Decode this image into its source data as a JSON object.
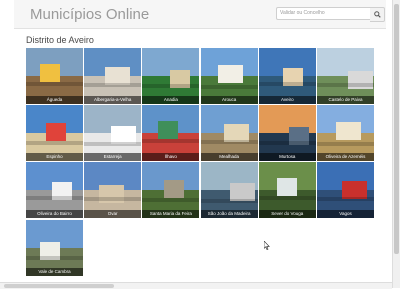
{
  "header": {
    "title": "Municípios Online",
    "search_placeholder": "Validar ou Concelho",
    "search_icon": "search-icon"
  },
  "section": {
    "title": "Distrito de Aveiro"
  },
  "municipalities": [
    {
      "name": "Águeda",
      "slug": "agueda",
      "sky": "#7d9fc0",
      "ground": "#8a6a45",
      "accent": "#f0c040"
    },
    {
      "name": "Albergaria-a-Velha",
      "slug": "albergaria-a-velha",
      "sky": "#5f8fc4",
      "ground": "#c9c2b6",
      "accent": "#e8e1d3"
    },
    {
      "name": "Anadia",
      "slug": "anadia",
      "sky": "#7ea8d0",
      "ground": "#2f7a35",
      "accent": "#d8c9a3"
    },
    {
      "name": "Arouca",
      "slug": "arouca",
      "sky": "#6ea2d8",
      "ground": "#4a7a3a",
      "accent": "#f2efe6"
    },
    {
      "name": "Aveiro",
      "slug": "aveiro",
      "sky": "#3f76b8",
      "ground": "#2f5a7a",
      "accent": "#e7d3b0"
    },
    {
      "name": "Castelo de Paiva",
      "slug": "castelo-de-paiva",
      "sky": "#bcd0e0",
      "ground": "#6f8f5a",
      "accent": "#d9d9d9"
    },
    {
      "name": "Espinho",
      "slug": "espinho",
      "sky": "#4a86c9",
      "ground": "#d9c9a0",
      "accent": "#e0433a"
    },
    {
      "name": "Estarreja",
      "slug": "estarreja",
      "sky": "#9cb4c8",
      "ground": "#e9e9e9",
      "accent": "#ffffff"
    },
    {
      "name": "Ílhavo",
      "slug": "ilhavo",
      "sky": "#5e92c9",
      "ground": "#c9413a",
      "accent": "#3f8f5a"
    },
    {
      "name": "Mealhada",
      "slug": "mealhada",
      "sky": "#6f9fd2",
      "ground": "#a08a64",
      "accent": "#e4d7b8"
    },
    {
      "name": "Murtosa",
      "slug": "murtosa",
      "sky": "#e39a56",
      "ground": "#22384f",
      "accent": "#5a6f86"
    },
    {
      "name": "Oliveira de Azeméis",
      "slug": "oliveira-de-azemeis",
      "sky": "#84aee0",
      "ground": "#b79a5e",
      "accent": "#efe6cf"
    },
    {
      "name": "Oliveira do Bairro",
      "slug": "oliveira-do-bairro",
      "sky": "#5d90cf",
      "ground": "#9a9a9a",
      "accent": "#f2f2f2"
    },
    {
      "name": "Ovar",
      "slug": "ovar",
      "sky": "#5c88c4",
      "ground": "#c6b7a0",
      "accent": "#d7c7ab"
    },
    {
      "name": "Santa Maria da Feira",
      "slug": "santa-maria-da-feira",
      "sky": "#6a98cc",
      "ground": "#4e6f35",
      "accent": "#a39a86"
    },
    {
      "name": "São João da Madeira",
      "slug": "sao-joao-da-madeira",
      "sky": "#9cb6c6",
      "ground": "#3f5a6f",
      "accent": "#c9c9c9"
    },
    {
      "name": "Sever do Vouga",
      "slug": "sever-do-vouga",
      "sky": "#6b8f4a",
      "ground": "#3d5a2c",
      "accent": "#dfe6e6"
    },
    {
      "name": "Vagos",
      "slug": "vagos",
      "sky": "#3b6fb5",
      "ground": "#2f4f78",
      "accent": "#c9302c"
    },
    {
      "name": "Vale de Cambra",
      "slug": "vale-de-cambra",
      "sky": "#6b9ad0",
      "ground": "#6d7a56",
      "accent": "#efefe8"
    }
  ]
}
